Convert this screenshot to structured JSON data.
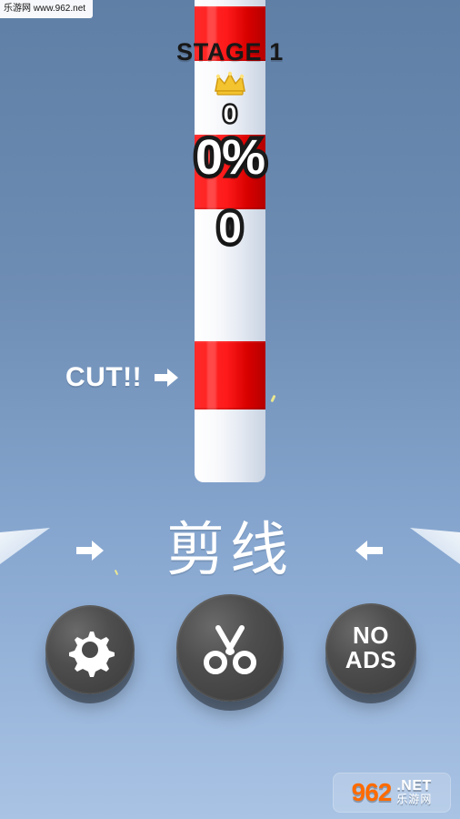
{
  "watermark_top": {
    "text": "乐游网 www.962.net"
  },
  "hud": {
    "stage": "STAGE 1",
    "crown_count": "0",
    "percent": "0%",
    "score": "0"
  },
  "hint": {
    "cut": "CUT!!"
  },
  "main": {
    "cut_line_label": "剪线"
  },
  "buttons": {
    "noads_line1": "NO",
    "noads_line2": "ADS"
  },
  "watermark_bottom": {
    "brand_number": "962",
    "brand_domain": ".NET",
    "brand_cn": "乐游网"
  },
  "icons": {
    "crown": "crown-icon",
    "arrow_right": "arrow-right-icon",
    "arrow_left": "arrow-left-icon",
    "settings": "gear-icon",
    "cut": "scissors-icon"
  },
  "colors": {
    "pole_red": "#ff1a1a",
    "pole_white": "#ffffff",
    "button_dark": "#4e4e4e",
    "text_white": "#ffffff",
    "text_dark": "#181818",
    "crown_gold": "#f4c430",
    "watermark_orange": "#ff6b00"
  }
}
